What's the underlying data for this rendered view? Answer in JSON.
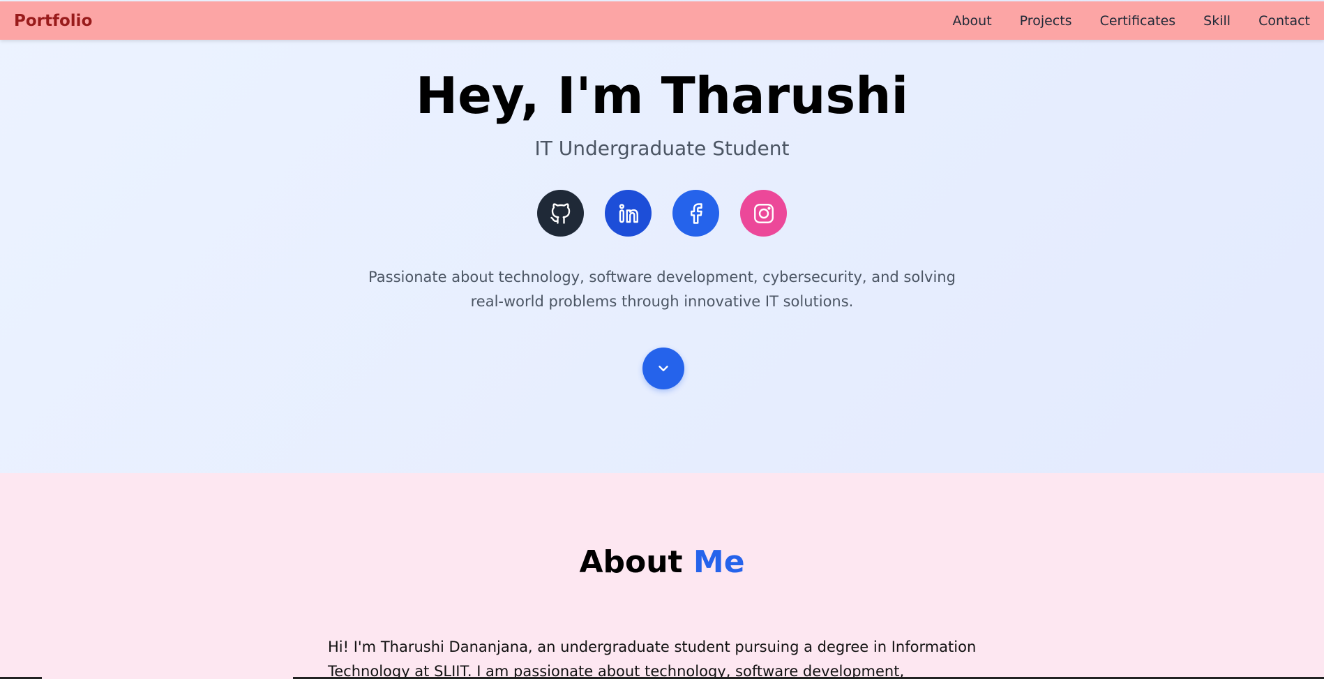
{
  "navbar": {
    "brand": "Portfolio",
    "links": [
      "About",
      "Projects",
      "Certificates",
      "Skill",
      "Contact"
    ]
  },
  "hero": {
    "title": "Hey, I'm Tharushi",
    "subtitle": "IT Undergraduate Student",
    "description": "Passionate about technology, software development, cybersecurity, and solving real-world problems through innovative IT solutions.",
    "socials": [
      {
        "icon": "github-icon",
        "color": "#1f2937"
      },
      {
        "icon": "linkedin-icon",
        "color": "#1d4ed8"
      },
      {
        "icon": "facebook-icon",
        "color": "#2563eb"
      },
      {
        "icon": "instagram-icon",
        "color": "#ec4899"
      }
    ],
    "scroll_icon": "chevron-down-icon"
  },
  "about": {
    "title_main": "About",
    "title_accent": "Me",
    "text": "Hi! I'm Tharushi Dananjana, an undergraduate student pursuing a degree in Information Technology at SLIIT. I am passionate about technology, software development, cybersecurity,"
  },
  "colors": {
    "navbar_bg": "#fca5a5",
    "brand": "#991b1b",
    "accent": "#2563eb",
    "about_bg": "#fde7f1"
  }
}
